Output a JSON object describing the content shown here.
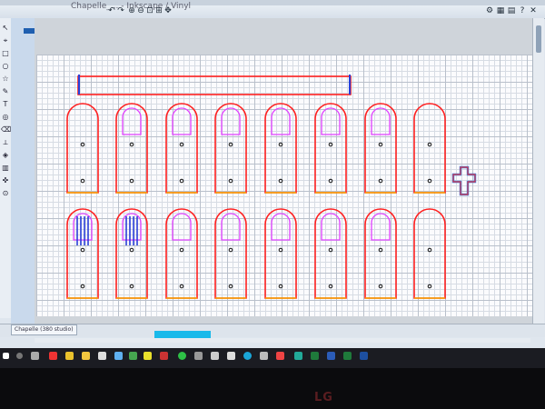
{
  "window": {
    "title": "Chapelle_... - Inkscape / Vinyl"
  },
  "document_tab": {
    "label": "Chapelle (380 studio)"
  },
  "toolbar": {
    "icons": [
      "new-icon",
      "open-icon",
      "save-icon",
      "undo-icon",
      "redo-icon",
      "zoom-in-icon",
      "zoom-out-icon",
      "zoom-fit-icon",
      "pan-icon",
      "settings-icon"
    ]
  },
  "colors": {
    "outline": "#ff2020",
    "inner_outline": "#e040ff",
    "mullion": "#2a3fd8",
    "base_line": "#f5a400",
    "cross": "#3b7fe0",
    "accent": "#19b9ea"
  },
  "design": {
    "row1_count": 8,
    "row2_count": 8,
    "row1_inner": [
      "none",
      "arch",
      "arch",
      "arch",
      "arch",
      "arch",
      "arch",
      "none"
    ],
    "row2_inner": [
      "bars",
      "bars",
      "arch",
      "arch",
      "arch",
      "arch",
      "arch",
      "none"
    ]
  },
  "brand": {
    "logo": "LG"
  }
}
